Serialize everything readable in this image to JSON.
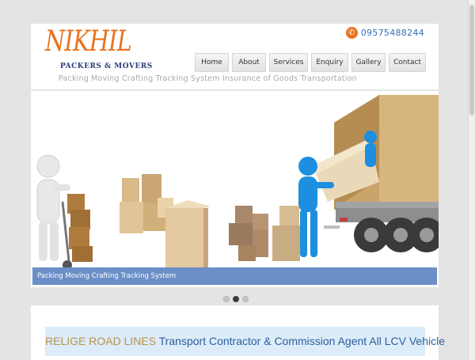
{
  "header": {
    "logo_main": "NIKHIL",
    "logo_sub": "PACKERS & MOVERS",
    "tagline": "Packing Moving Crafting Tracking System Insurance of Goods Transportation",
    "phone": "09575488244"
  },
  "nav": {
    "items": [
      {
        "label": "Home"
      },
      {
        "label": "About"
      },
      {
        "label": "Services"
      },
      {
        "label": "Enquiry"
      },
      {
        "label": "Gallery"
      },
      {
        "label": "Contact"
      }
    ]
  },
  "slider": {
    "caption": "Packing Moving Crafting Tracking System",
    "dots": [
      false,
      true,
      false
    ]
  },
  "banner": {
    "company": "RELIGE ROAD LINES",
    "description": "Transport Contractor & Commission Agent All LCV Vehicle"
  },
  "colors": {
    "brand_orange": "#e8731f",
    "brand_blue": "#2c3e7a",
    "link_blue": "#2e6fb3",
    "caption_bg": "#6b8fc6",
    "banner_bg": "#dcecf8"
  }
}
